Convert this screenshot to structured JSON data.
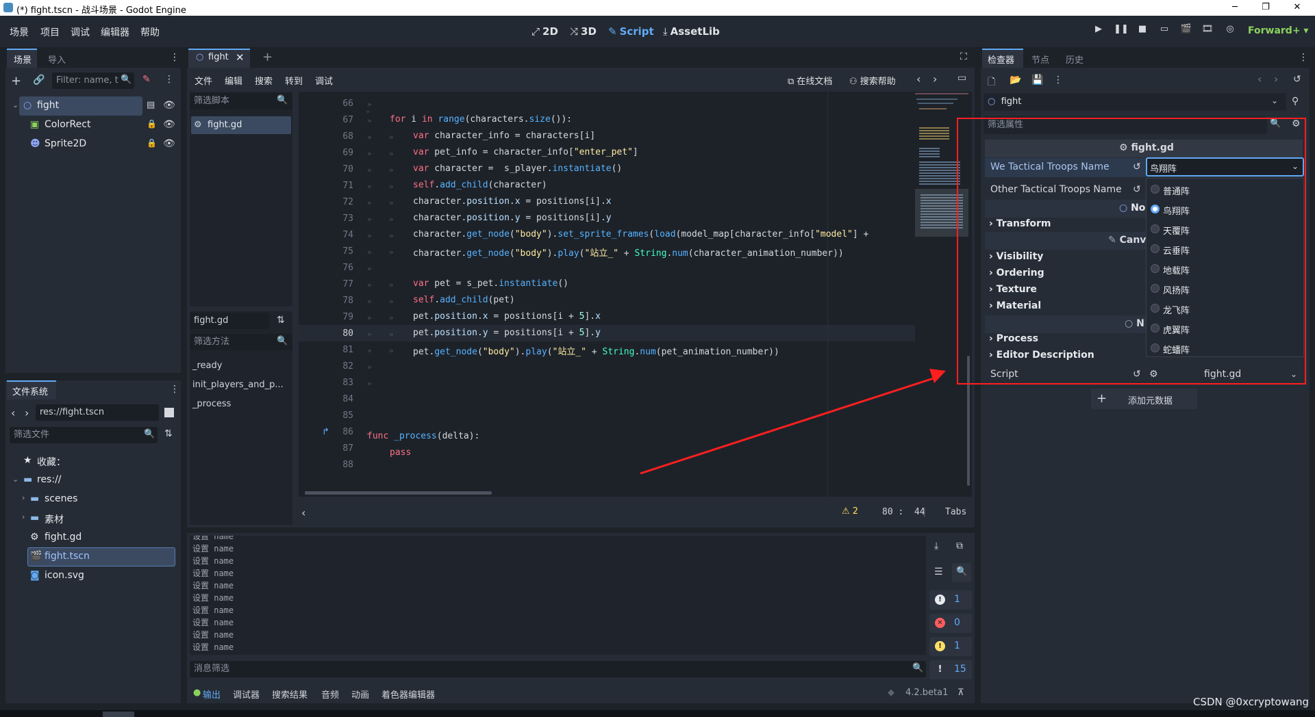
{
  "window": {
    "title": "(*) fight.tscn - 战斗场景 - Godot Engine",
    "minimize": "─",
    "maximize": "❐",
    "close": "✕"
  },
  "menu": [
    "场景",
    "项目",
    "调试",
    "编辑器",
    "帮助"
  ],
  "workspaces": [
    {
      "label": "2D",
      "icon": "⤢"
    },
    {
      "label": "3D",
      "icon": "⤨"
    },
    {
      "label": "Script",
      "icon": "✎"
    },
    {
      "label": "AssetLib",
      "icon": "⤓"
    }
  ],
  "renderer": "Forward+",
  "scene_dock": {
    "tabs": [
      "场景",
      "导入"
    ],
    "filter_placeholder": "Filter: name, t",
    "nodes": [
      {
        "name": "fight",
        "icon": "○"
      },
      {
        "name": "ColorRect",
        "icon": "▣"
      },
      {
        "name": "Sprite2D",
        "icon": "☻"
      }
    ]
  },
  "filesystem": {
    "title": "文件系统",
    "path": "res://fight.tscn",
    "filter_placeholder": "筛选文件",
    "favorites": "收藏：",
    "root": "res://",
    "items": [
      "scenes",
      "素材",
      "fight.gd",
      "fight.tscn",
      "icon.svg"
    ]
  },
  "script_editor": {
    "tab": "fight",
    "menu": [
      "文件",
      "编辑",
      "搜索",
      "转到",
      "调试"
    ],
    "online_docs": "在线文档",
    "search_help": "搜索帮助",
    "filter_scripts": "筛选脚本",
    "script_list": [
      "fight.gd"
    ],
    "current_script": "fight.gd",
    "filter_methods": "筛选方法",
    "methods": [
      "_ready",
      "init_players_and_p...",
      "_process"
    ],
    "warnings": "2",
    "cursor": "80 :  44",
    "indent": "Tabs",
    "line_numbers": [
      "66",
      "67",
      "68",
      "69",
      "70",
      "71",
      "72",
      "73",
      "74",
      "75",
      "76",
      "77",
      "78",
      "79",
      "80",
      "81",
      "82",
      "83",
      "84",
      "85",
      "86",
      "87",
      "88"
    ]
  },
  "output": {
    "lines": [
      "设置 name",
      "设置 name",
      "设置 name",
      "设置 name",
      "设置 name",
      "设置 name",
      "设置 name",
      "设置 name",
      "设置 name",
      "设置 name"
    ],
    "filter_placeholder": "消息筛选",
    "counts": {
      "messages": "1",
      "errors": "0",
      "warnings": "1",
      "total": "15"
    },
    "tabs": [
      "输出",
      "调试器",
      "搜索结果",
      "音频",
      "动画",
      "着色器编辑器"
    ],
    "version": "4.2.beta1"
  },
  "inspector": {
    "tabs": [
      "检查器",
      "节点",
      "历史"
    ],
    "node": "fight",
    "filter_placeholder": "筛选属性",
    "script_header": "fight.gd",
    "props": {
      "we_label": "We Tactical Troops Name",
      "we_value": "鸟翔阵",
      "other_label": "Other Tactical Troops Name"
    },
    "partial_headers": [
      "No",
      "Canv",
      "N"
    ],
    "sections": [
      "Transform",
      "Visibility",
      "Ordering",
      "Texture",
      "Material",
      "Process",
      "Editor Description"
    ],
    "script_label": "Script",
    "script_value": "fight.gd",
    "add_metadata": "添加元数据",
    "dropdown_options": [
      "普通阵",
      "鸟翔阵",
      "天覆阵",
      "云垂阵",
      "地载阵",
      "风扬阵",
      "龙飞阵",
      "虎翼阵",
      "蛇蟠阵"
    ],
    "selected_option": "鸟翔阵"
  },
  "annotation_color": "#ff1f1f",
  "watermark": "CSDN @0xcryptowang"
}
